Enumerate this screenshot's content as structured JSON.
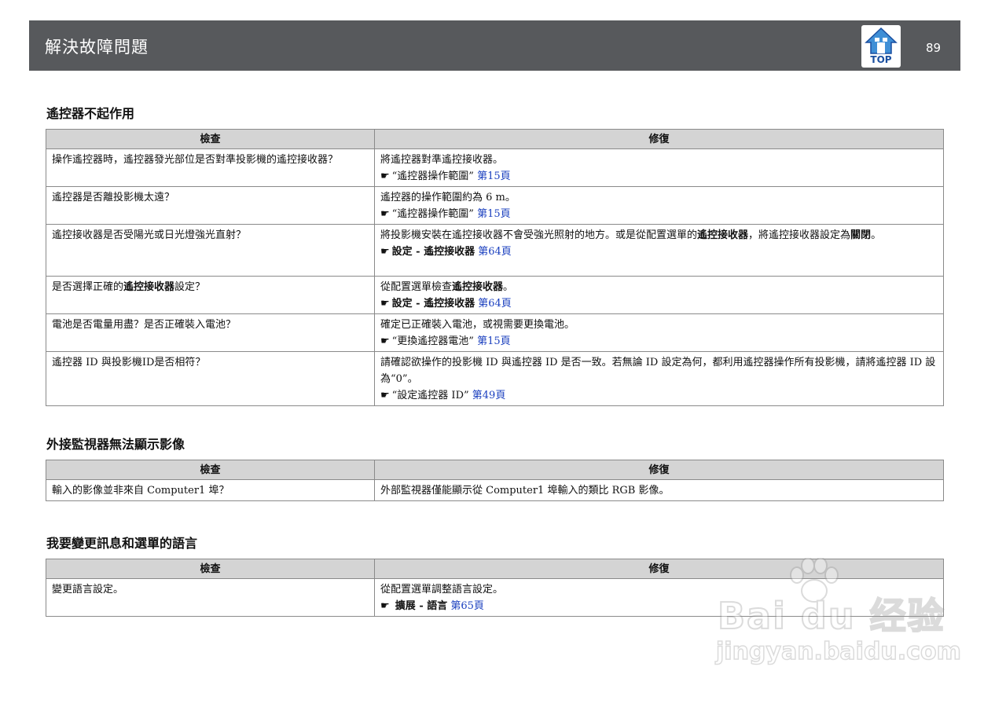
{
  "header": {
    "title": "解決故障問題",
    "top_label": "TOP",
    "page_number": "89"
  },
  "table_headers": {
    "check": "檢查",
    "fix": "修復"
  },
  "sections": [
    {
      "title": "遙控器不起作用",
      "rows": [
        {
          "check": "操作遙控器時，遙控器發光部位是否對準投影機的遙控接收器？",
          "fix_text": "將遙控器對準遙控接收器。",
          "ref_text": "“遙控器操作範圍”",
          "ref_page": "第15頁"
        },
        {
          "check": "遙控器是否離投影機太遠？",
          "fix_text": "遙控器的操作範圍約為 6 m。",
          "ref_text": "“遙控器操作範圍”",
          "ref_page": "第15頁"
        },
        {
          "check": "遙控接收器是否受陽光或日光燈強光直射？",
          "fix_pre": "將投影機安裝在遙控接收器不會受強光照射的地方。或是從配置選單的",
          "fix_bold1": "遙控接收器",
          "fix_mid": "，將遙控接收器設定為",
          "fix_bold2": "關閉",
          "fix_end": "。",
          "ref_bold": "設定 - 遙控接收器",
          "ref_page": "第64頁"
        },
        {
          "check_pre": "是否選擇正確的",
          "check_bold": "遙控接收器",
          "check_end": "設定？",
          "fix_pre": "從配置選單檢查",
          "fix_bold": "遙控接收器",
          "fix_end": "。",
          "ref_bold": "設定 - 遙控接收器",
          "ref_page": "第64頁"
        },
        {
          "check": "電池是否電量用盡？是否正確裝入電池？",
          "fix_text": "確定已正確裝入電池，或視需要更換電池。",
          "ref_text": "“更換遙控器電池”",
          "ref_page": "第15頁"
        },
        {
          "check": "遙控器 ID 與投影機ID是否相符？",
          "fix_text": "請確認欲操作的投影機 ID 與遙控器 ID 是否一致。若無論 ID 設定為何，都利用遙控器操作所有投影機，請將遙控器 ID 設為“0”。",
          "ref_text": "“設定遙控器 ID”",
          "ref_page": "第49頁"
        }
      ]
    },
    {
      "title": "外接監視器無法顯示影像",
      "rows": [
        {
          "check": "輸入的影像並非來自 Computer1 埠？",
          "fix_text": "外部監視器僅能顯示從 Computer1 埠輸入的類比 RGB 影像。"
        }
      ]
    },
    {
      "title": "我要變更訊息和選單的語言",
      "rows": [
        {
          "check": "變更語言設定。",
          "fix_text": "從配置選單調整語言設定。",
          "ref_bold": "擴展 - 語言",
          "ref_page": "第65頁"
        }
      ]
    }
  ],
  "watermark": {
    "brand": "Bai du 经验",
    "url": "jingyan.baidu.com"
  }
}
